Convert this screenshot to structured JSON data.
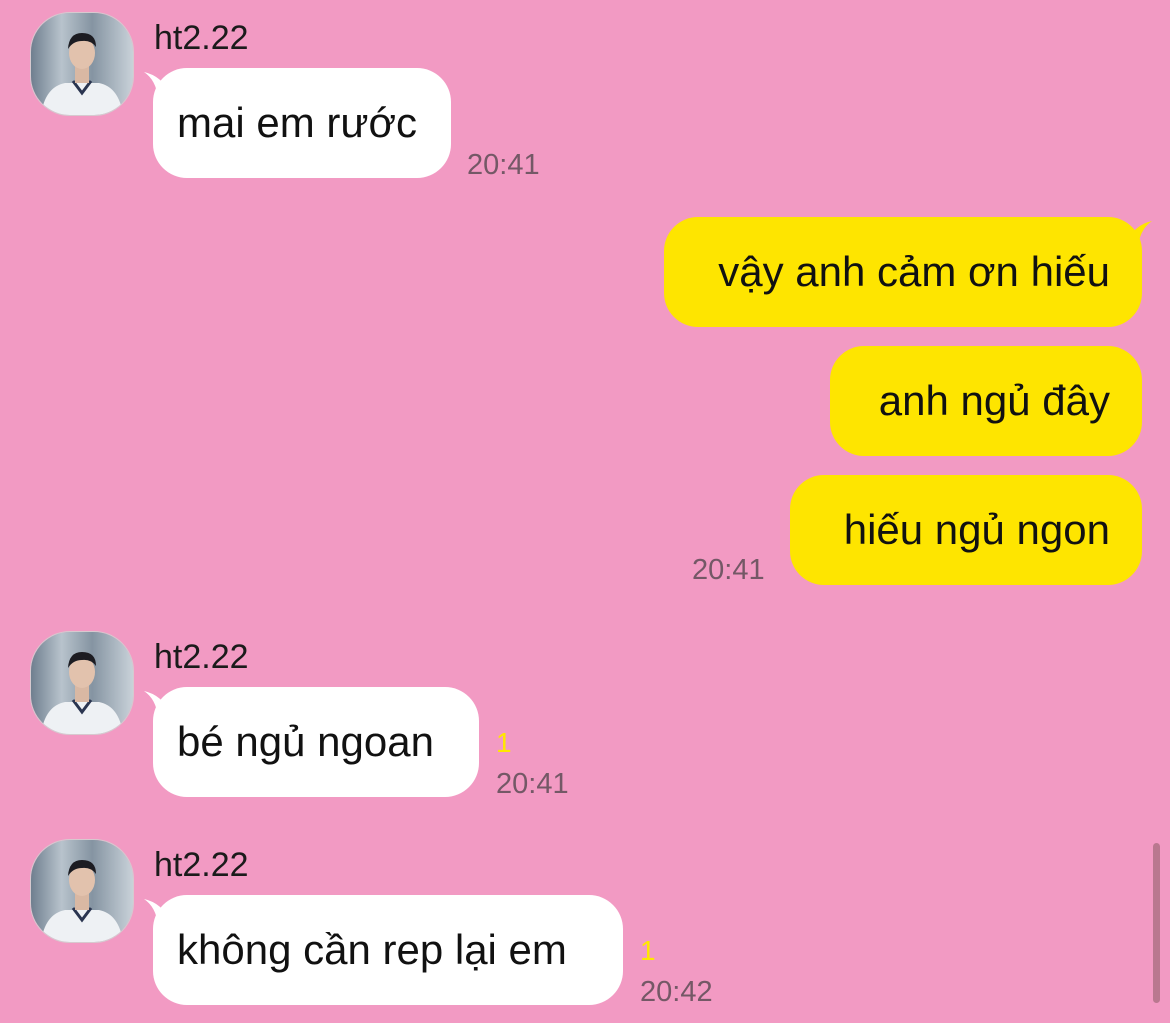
{
  "colors": {
    "background": "#f29ac3",
    "incoming_bubble": "#ffffff",
    "outgoing_bubble": "#fee500",
    "unread_count": "#ffe700",
    "timestamp": "#745866"
  },
  "messages": [
    {
      "sender": "ht2.22",
      "text": "mai em rước",
      "time": "20:41"
    },
    {
      "text": "vậy anh cảm ơn hiếu"
    },
    {
      "text": "anh ngủ đây"
    },
    {
      "text": "hiếu ngủ ngon",
      "time": "20:41"
    },
    {
      "sender": "ht2.22",
      "text": "bé ngủ ngoan",
      "unread": "1",
      "time": "20:41"
    },
    {
      "sender": "ht2.22",
      "text": "không cần rep lại em",
      "unread": "1",
      "time": "20:42"
    }
  ],
  "icons": {
    "avatar": "profile-photo",
    "scrollbar": "scroll-thumb"
  }
}
